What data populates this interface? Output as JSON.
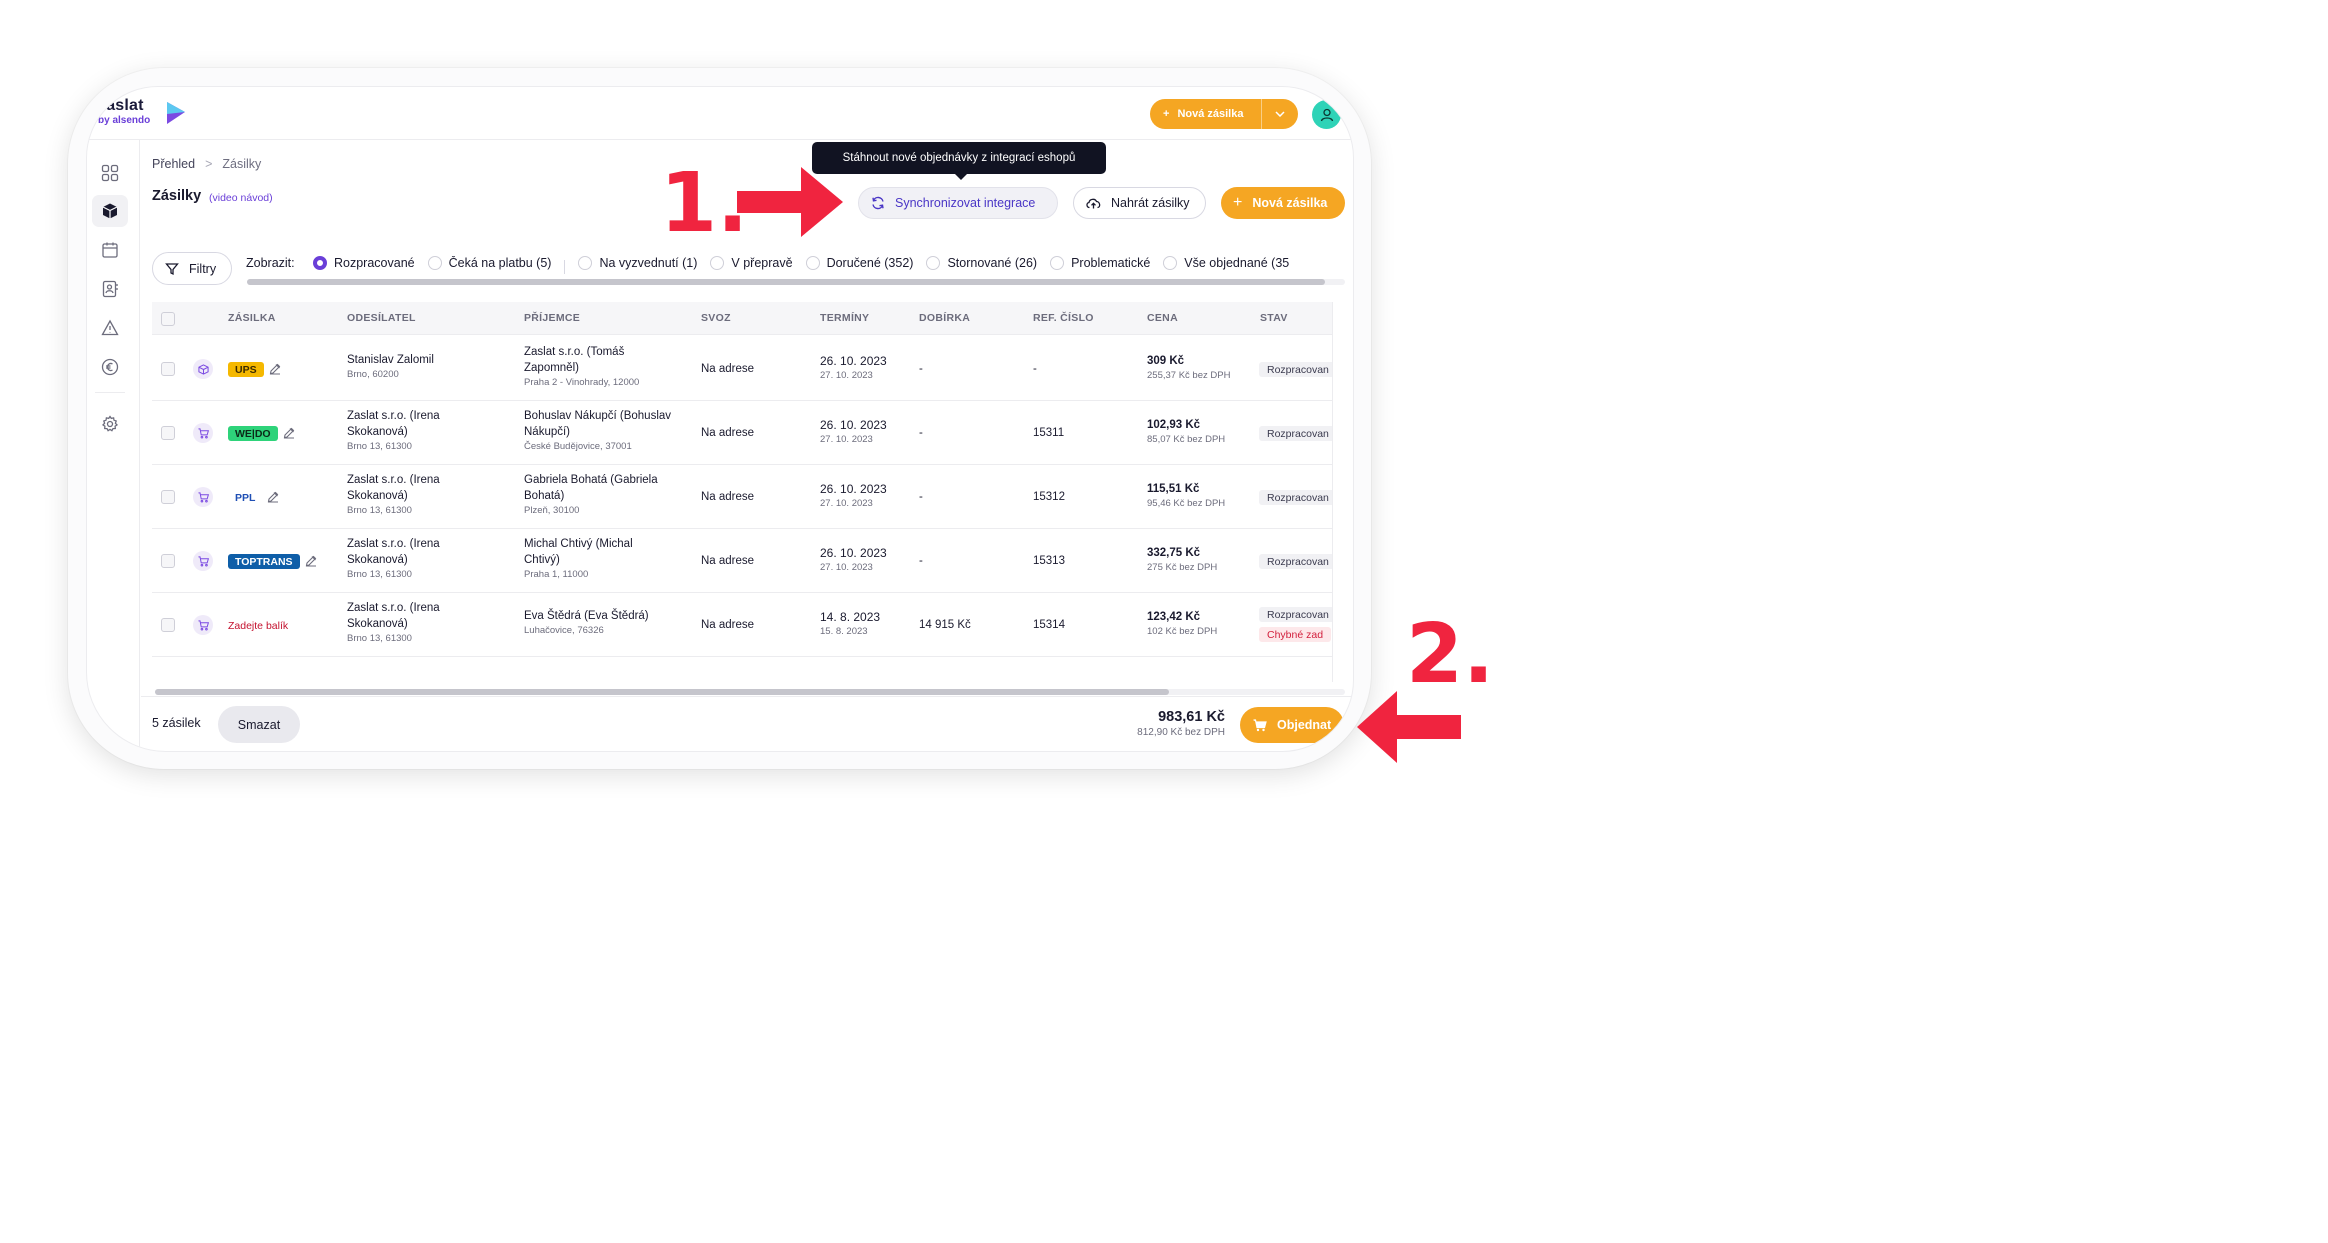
{
  "app": {
    "logo_word": "zaslat",
    "logo_by": "by alsendo",
    "top_new_label": "Nová zásilka"
  },
  "breadcrumb": {
    "home": "Přehled",
    "current": "Zásilky"
  },
  "page": {
    "title": "Zásilky",
    "video_link": "(video návod)"
  },
  "tooltip": "Stáhnout nové objednávky z integrací eshopů",
  "actions": {
    "sync_label": "Synchronizovat integrace",
    "upload_label": "Nahrát zásilky",
    "new_label": "Nová zásilka"
  },
  "filters": {
    "button_label": "Filtry",
    "show_label": "Zobrazit:",
    "options": [
      {
        "label": "Rozpracované",
        "selected": true
      },
      {
        "label": "Čeká na platbu (5)",
        "selected": false
      },
      {
        "label": "Na vyzvednutí (1)",
        "selected": false
      },
      {
        "label": "V přepravě",
        "selected": false
      },
      {
        "label": "Doručené (352)",
        "selected": false
      },
      {
        "label": "Stornované (26)",
        "selected": false
      },
      {
        "label": "Problematické",
        "selected": false
      },
      {
        "label": "Vše objednané (35",
        "selected": false
      }
    ]
  },
  "table": {
    "headers": [
      "ZÁSILKA",
      "ODESÍLATEL",
      "PŘÍJEMCE",
      "SVOZ",
      "TERMÍNY",
      "DOBÍRKA",
      "REF. ČÍSLO",
      "CENA",
      "STAV"
    ],
    "rows": [
      {
        "carrier": "UPS",
        "carrier_bg": "#f5b800",
        "carrier_fg": "#3b2a00",
        "icon": "package-icon",
        "sender_name": "Stanislav Zalomil",
        "sender_name2": "",
        "sender_addr": "Brno, 60200",
        "recipient_name": "Zaslat s.r.o. (Tomáš",
        "recipient_name2": "Zapomněl)",
        "recipient_addr": "Praha 2 - Vinohrady, 12000",
        "pickup": "Na adrese",
        "date": "26. 10. 2023",
        "date2": "27. 10. 2023",
        "cod": "-",
        "ref": "-",
        "price": "309 Kč",
        "price_net": "255,37 Kč bez DPH",
        "status": "Rozpracovan",
        "status2": ""
      },
      {
        "carrier": "WE|DO",
        "carrier_bg": "#2ed37a",
        "carrier_fg": "#0b2a18",
        "icon": "cart-icon",
        "sender_name": "Zaslat s.r.o. (Irena",
        "sender_name2": "Skokanová)",
        "sender_addr": "Brno 13, 61300",
        "recipient_name": "Bohuslav Nákupčí (Bohuslav",
        "recipient_name2": "Nákupčí)",
        "recipient_addr": "České Budějovice, 37001",
        "pickup": "Na adrese",
        "date": "26. 10. 2023",
        "date2": "27. 10. 2023",
        "cod": "-",
        "ref": "15311",
        "price": "102,93 Kč",
        "price_net": "85,07 Kč bez DPH",
        "status": "Rozpracovan",
        "status2": ""
      },
      {
        "carrier": "PPL",
        "carrier_bg": "#ffffff",
        "carrier_fg": "#1f4fb5",
        "icon": "cart-icon",
        "sender_name": "Zaslat s.r.o. (Irena",
        "sender_name2": "Skokanová)",
        "sender_addr": "Brno 13, 61300",
        "recipient_name": "Gabriela Bohatá (Gabriela",
        "recipient_name2": "Bohatá)",
        "recipient_addr": "Plzeň, 30100",
        "pickup": "Na adrese",
        "date": "26. 10. 2023",
        "date2": "27. 10. 2023",
        "cod": "-",
        "ref": "15312",
        "price": "115,51 Kč",
        "price_net": "95,46 Kč bez DPH",
        "status": "Rozpracovan",
        "status2": ""
      },
      {
        "carrier": "TOPTRANS",
        "carrier_bg": "#0e5ea8",
        "carrier_fg": "#ffffff",
        "icon": "cart-icon",
        "sender_name": "Zaslat s.r.o. (Irena",
        "sender_name2": "Skokanová)",
        "sender_addr": "Brno 13, 61300",
        "recipient_name": "Michal Chtivý (Michal",
        "recipient_name2": "Chtivý)",
        "recipient_addr": "Praha 1, 11000",
        "pickup": "Na adrese",
        "date": "26. 10. 2023",
        "date2": "27. 10. 2023",
        "cod": "-",
        "ref": "15313",
        "price": "332,75 Kč",
        "price_net": "275 Kč bez DPH",
        "status": "Rozpracovan",
        "status2": ""
      },
      {
        "carrier": "Zadejte balík",
        "carrier_bg": "transparent",
        "carrier_fg": "#c4122f",
        "icon": "cart-icon",
        "sender_name": "Zaslat s.r.o. (Irena",
        "sender_name2": "Skokanová)",
        "sender_addr": "Brno 13, 61300",
        "recipient_name": "Eva Štědrá (Eva Štědrá)",
        "recipient_name2": "",
        "recipient_addr": "Luhačovice, 76326",
        "pickup": "Na adrese",
        "date": "14. 8. 2023",
        "date2": "15. 8. 2023",
        "cod": "14 915 Kč",
        "ref": "15314",
        "price": "123,42 Kč",
        "price_net": "102 Kč bez DPH",
        "status": "Rozpracovan",
        "status2": "Chybné zad"
      }
    ]
  },
  "footer": {
    "count": "5 zásilek",
    "delete_label": "Smazat",
    "total": "983,61 Kč",
    "total_net": "812,90 Kč bez DPH",
    "order_label": "Objednat"
  },
  "annotations": {
    "step1": "1.",
    "step2": "2.",
    "color": "#f0243f"
  }
}
